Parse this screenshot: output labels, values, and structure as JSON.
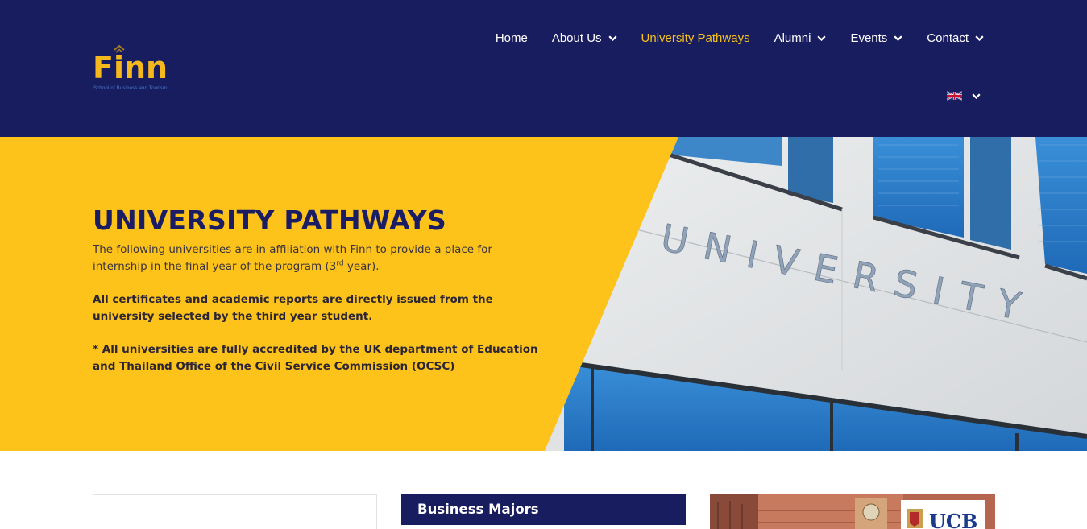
{
  "brand": {
    "name": "Finn",
    "tagline": "School of Business and Tourism",
    "colors": {
      "navy": "#181d60",
      "yellow": "#fdc31a",
      "accent": "#f5c11a"
    }
  },
  "nav": {
    "items": [
      {
        "label": "Home",
        "dropdown": false,
        "active": false
      },
      {
        "label": "About Us",
        "dropdown": true,
        "active": false
      },
      {
        "label": "University Pathways",
        "dropdown": false,
        "active": true
      },
      {
        "label": "Alumni",
        "dropdown": true,
        "active": false
      },
      {
        "label": "Events",
        "dropdown": true,
        "active": false
      },
      {
        "label": "Contact",
        "dropdown": true,
        "active": false
      }
    ],
    "language": {
      "icon": "uk-flag-icon"
    }
  },
  "hero": {
    "title": "UNIVERSITY PATHWAYS",
    "intro_before": "The following universities are in affiliation with Finn to provide a place for internship in the final year of the program (3",
    "intro_sup": "rd",
    "intro_after": " year).",
    "bold_1": "All certificates and academic reports are directly issued from the university selected by the third year student.",
    "bold_2": "* All universities are fully accredited by the UK department of Education and Thailand Office of the Civil Service Commission (OCSC)",
    "photo_sign": "UNIVERSITY"
  },
  "cards": {
    "middle_title": "Business Majors",
    "right_logo": "UCB"
  }
}
